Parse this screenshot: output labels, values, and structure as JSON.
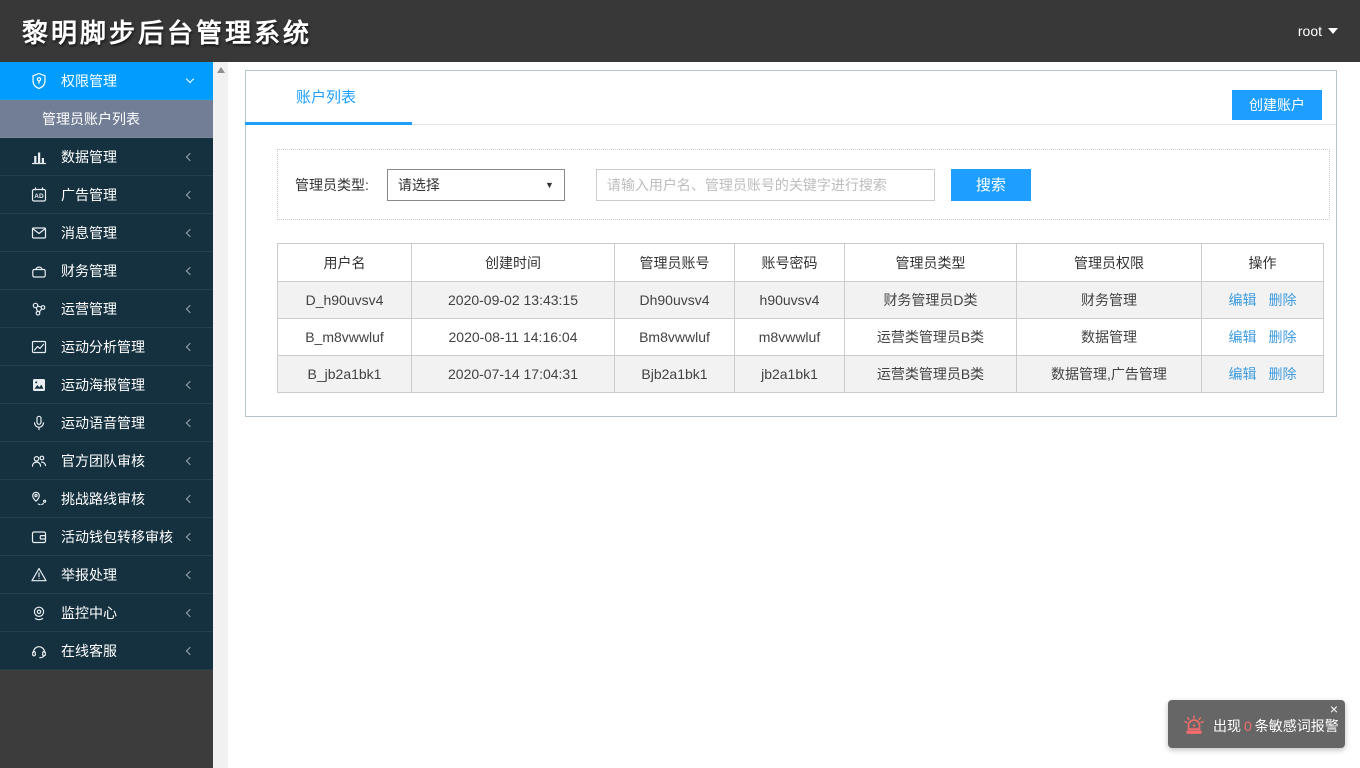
{
  "header": {
    "logo": "黎明脚步后台管理系统",
    "user": "root"
  },
  "sidebar": {
    "active_item": {
      "label": "权限管理",
      "icon": "shield-icon"
    },
    "active_sub_item": {
      "label": "管理员账户列表"
    },
    "items": [
      {
        "label": "数据管理",
        "icon": "bar-chart-icon"
      },
      {
        "label": "广告管理",
        "icon": "ad-icon"
      },
      {
        "label": "消息管理",
        "icon": "envelope-icon"
      },
      {
        "label": "财务管理",
        "icon": "purse-icon"
      },
      {
        "label": "运营管理",
        "icon": "share-nodes-icon"
      },
      {
        "label": "运动分析管理",
        "icon": "analytics-chart-icon"
      },
      {
        "label": "运动海报管理",
        "icon": "poster-image-icon"
      },
      {
        "label": "运动语音管理",
        "icon": "microphone-icon"
      },
      {
        "label": "官方团队审核",
        "icon": "team-icon"
      },
      {
        "label": "挑战路线审核",
        "icon": "route-pin-icon"
      },
      {
        "label": "活动钱包转移审核",
        "icon": "wallet-icon"
      },
      {
        "label": "举报处理",
        "icon": "warning-icon"
      },
      {
        "label": "监控中心",
        "icon": "webcam-icon"
      },
      {
        "label": "在线客服",
        "icon": "headset-icon"
      }
    ]
  },
  "main": {
    "tab": "账户列表",
    "create_button": "创建账户",
    "filter": {
      "label": "管理员类型:",
      "select_value": "请选择",
      "search_placeholder": "请输入用户名、管理员账号的关键字进行搜索",
      "search_button": "搜索"
    },
    "table": {
      "headers": [
        "用户名",
        "创建时间",
        "管理员账号",
        "账号密码",
        "管理员类型",
        "管理员权限",
        "操作"
      ],
      "edit_label": "编辑",
      "delete_label": "删除",
      "rows": [
        {
          "username": "D_h90uvsv4",
          "created": "2020-09-02 13:43:15",
          "account": "Dh90uvsv4",
          "password": "h90uvsv4",
          "type": "财务管理员D类",
          "permission": "财务管理"
        },
        {
          "username": "B_m8vwwluf",
          "created": "2020-08-11 14:16:04",
          "account": "Bm8vwwluf",
          "password": "m8vwwluf",
          "type": "运营类管理员B类",
          "permission": "数据管理"
        },
        {
          "username": "B_jb2a1bk1",
          "created": "2020-07-14 17:04:31",
          "account": "Bjb2a1bk1",
          "password": "jb2a1bk1",
          "type": "运营类管理员B类",
          "permission": "数据管理,广告管理"
        }
      ]
    }
  },
  "toast": {
    "prefix": "出现",
    "count": "0",
    "suffix": "条敏感词报警",
    "close": "×"
  },
  "colors": {
    "accent_blue": "#1e9fff",
    "active_menu_blue": "#009dff",
    "sidebar_bg": "#15303f",
    "submenu_bg": "#727e96",
    "header_bg": "#383838",
    "link_blue": "#3e9bdf",
    "danger_red": "#f56c6c"
  }
}
